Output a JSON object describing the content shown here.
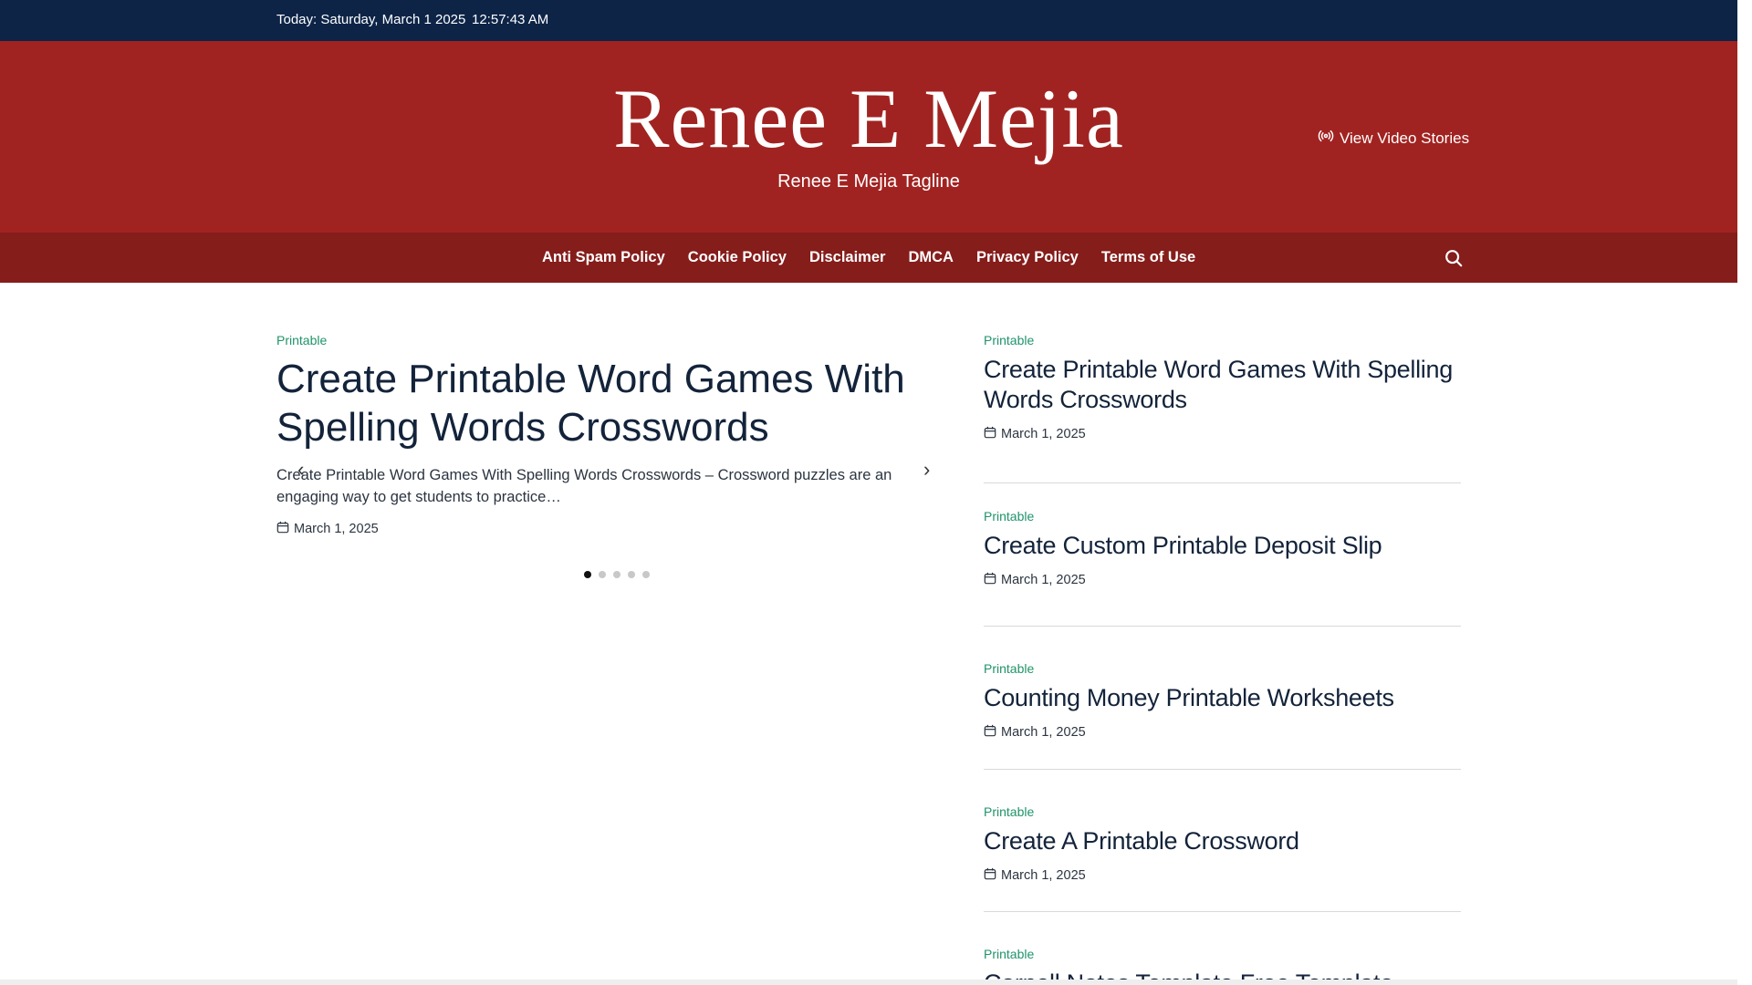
{
  "topbar": {
    "date": "Today: Saturday, March 1 2025",
    "time": "12:57:43 AM"
  },
  "site": {
    "title": "Renee E Mejia",
    "tagline": "Renee E Mejia Tagline",
    "video_stories_label": "View Video Stories"
  },
  "nav": {
    "items": [
      "Anti Spam Policy",
      "Cookie Policy",
      "Disclaimer",
      "DMCA",
      "Privacy Policy",
      "Terms of Use"
    ]
  },
  "featured": {
    "category": "Printable",
    "title": "Create Printable Word Games With Spelling Words Crosswords",
    "excerpt": "Create Printable Word Games With Spelling Words Crosswords – Crossword puzzles are an engaging way to get students to practice…",
    "date": "March 1, 2025",
    "slide_count": 5,
    "active_slide": 1
  },
  "sidebar": {
    "posts": [
      {
        "category": "Printable",
        "title": "Create Printable Word Games With Spelling Words Crosswords",
        "date": "March 1, 2025"
      },
      {
        "category": "Printable",
        "title": "Create Custom Printable Deposit Slip",
        "date": "March 1, 2025"
      },
      {
        "category": "Printable",
        "title": "Counting Money Printable Worksheets",
        "date": "March 1, 2025"
      },
      {
        "category": "Printable",
        "title": "Create A Printable Crossword",
        "date": "March 1, 2025"
      },
      {
        "category": "Printable",
        "title": "Cornell Notes Template Free Template"
      }
    ]
  },
  "colors": {
    "topbar": "#0d2447",
    "masthead": "#a12321",
    "navbar": "#851d1b",
    "category": "#20946a"
  }
}
